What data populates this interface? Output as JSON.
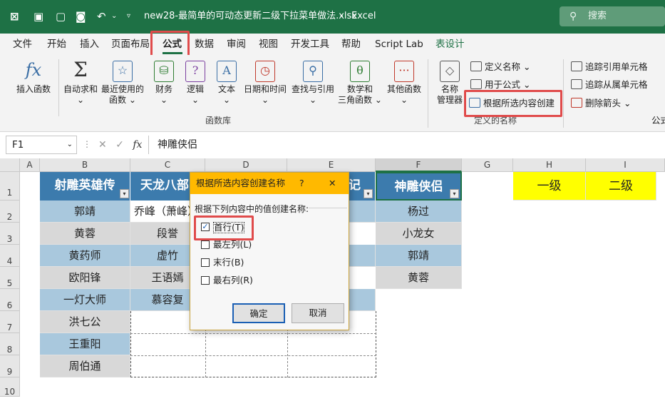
{
  "titlebar": {
    "filename": "new28-最简单的可动态更新二级下拉菜单做法.xlsx",
    "separator": "-",
    "app": "Excel",
    "search_placeholder": "搜索"
  },
  "menu": [
    "文件",
    "开始",
    "插入",
    "页面布局",
    "公式",
    "数据",
    "审阅",
    "视图",
    "开发工具",
    "帮助",
    "Script Lab",
    "表设计"
  ],
  "ribbon": {
    "insert_function": "插入函数",
    "autosum": "自动求和",
    "recent": "最近使用的",
    "recent2": "函数",
    "finance": "财务",
    "logic": "逻辑",
    "text": "文本",
    "datetime": "日期和时间",
    "lookup": "查找与引用",
    "math": "数学和",
    "math2": "三角函数",
    "other": "其他函数",
    "group_library": "函数库",
    "name_manager": "名称",
    "name_manager2": "管理器",
    "define_name": "定义名称",
    "use_in_formula": "用于公式",
    "create_from_selection": "根据所选内容创建",
    "group_names": "定义的名称",
    "trace_precedents": "追踪引用单元格",
    "trace_dependents": "追踪从属单元格",
    "remove_arrows": "删除箭头",
    "formula_cut": "公式"
  },
  "formula_bar": {
    "name_box": "F1",
    "fx": "fx",
    "value": "神雕侠侣"
  },
  "columns": [
    "A",
    "B",
    "C",
    "D",
    "E",
    "F",
    "G",
    "H",
    "I"
  ],
  "rows": [
    "1",
    "2",
    "3",
    "4",
    "5",
    "6",
    "7",
    "8",
    "9",
    "10"
  ],
  "headers": {
    "B": "射雕英雄传",
    "C": "天龙八部",
    "E": "记",
    "F": "神雕侠侣"
  },
  "colB": [
    "郭靖",
    "黄蓉",
    "黄药师",
    "欧阳锋",
    "一灯大师",
    "洪七公",
    "王重阳",
    "周伯通"
  ],
  "colC": [
    "乔峰（萧峰）",
    "段誉",
    "虚竹",
    "王语嫣",
    "慕容复"
  ],
  "colF": [
    "杨过",
    "小龙女",
    "郭靖",
    "黄蓉"
  ],
  "levels": {
    "H": "一级",
    "I": "二级"
  },
  "dialog": {
    "title": "根据所选内容创建名称",
    "help": "?",
    "close": "✕",
    "prompt": "根据下列内容中的值创建名称:",
    "options": [
      {
        "label": "首行(T)",
        "checked": true
      },
      {
        "label": "最左列(L)",
        "checked": false
      },
      {
        "label": "末行(B)",
        "checked": false
      },
      {
        "label": "最右列(R)",
        "checked": false
      }
    ],
    "ok": "确定",
    "cancel": "取消"
  },
  "colors": {
    "excel_green": "#1e7145",
    "table_header": "#3c7bad",
    "band_dark": "#a9c8dd",
    "band_light": "#d8d8d8",
    "highlight": "#e04b4b",
    "dialog_title": "#ffb900"
  }
}
